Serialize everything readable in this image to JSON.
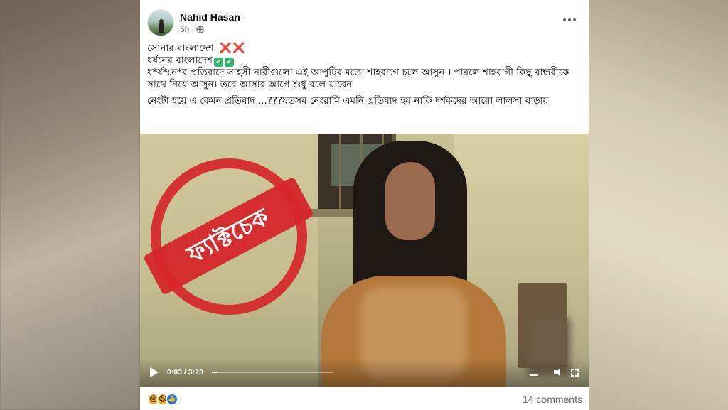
{
  "post": {
    "author_name": "Nahid Hasan",
    "timestamp": "5h",
    "separator": "·",
    "audience_icon": "globe-icon",
    "menu_icon": "more-horizontal-icon"
  },
  "text": {
    "line1": "সোনার বাংলাদেশ",
    "line1_emoji": "❌❌",
    "line2": "ধর্ষনের বাংলাদেশ",
    "line2_emoji1": "✔",
    "line2_emoji2": "✔",
    "para1": "ধ*র্ষ*নে*র প্রতিবাদে সাহসী নারীগুলো এই আপুটির মতো শাহবাগে চলে আসুন । পারলে শাহবাগী কিছু বান্ধবীকে সাথে নিয়ে আসুন। তবে আসার আগে শুধু বলে যাবেন",
    "para2": "নেংটা হয়ে এ কেমন প্রতিবাদ ...???যতসব নেংরামি এমনি প্রতিবাদ  হয় নাকি  দর্শকদের আরো লালসা বাড়ায়"
  },
  "video": {
    "stamp_text": "ফ্যাক্টচেক",
    "stamp_color": "#d6262a",
    "timecode": "0:03 / 3:23",
    "progress": 0.015,
    "play_icon": "play-icon",
    "settings_icon": "settings-icon",
    "volume_icon": "volume-icon",
    "fullscreen_icon": "fullscreen-icon"
  },
  "footer": {
    "reactions": [
      "sad",
      "haha",
      "like"
    ],
    "comments": "14 comments"
  }
}
